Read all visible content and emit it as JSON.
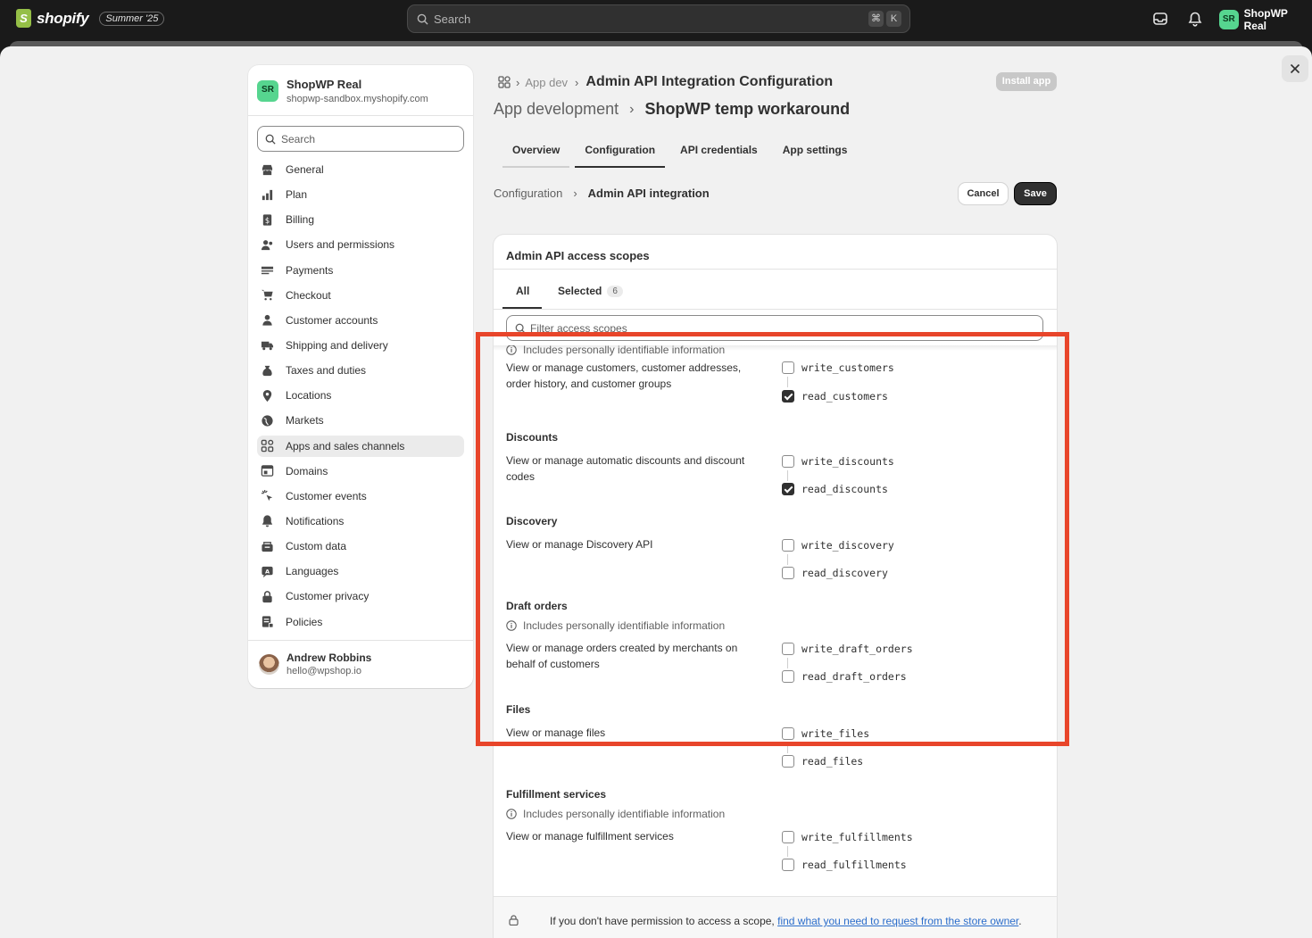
{
  "topbar": {
    "logo_text": "shopify",
    "logo_glyph": "S",
    "edition": "Summer '25",
    "search_placeholder": "Search",
    "shortcut_key1": "⌘",
    "shortcut_key2": "K",
    "store_initials": "SR",
    "store_label": "ShopWP Real"
  },
  "sidebar": {
    "store_initials": "SR",
    "store_name": "ShopWP Real",
    "store_url": "shopwp-sandbox.myshopify.com",
    "search_placeholder": "Search",
    "items": [
      {
        "label": "General",
        "icon": "store-icon"
      },
      {
        "label": "Plan",
        "icon": "plan-chart-icon"
      },
      {
        "label": "Billing",
        "icon": "billing-icon"
      },
      {
        "label": "Users and permissions",
        "icon": "users-icon"
      },
      {
        "label": "Payments",
        "icon": "payments-icon"
      },
      {
        "label": "Checkout",
        "icon": "cart-icon"
      },
      {
        "label": "Customer accounts",
        "icon": "person-icon"
      },
      {
        "label": "Shipping and delivery",
        "icon": "truck-icon"
      },
      {
        "label": "Taxes and duties",
        "icon": "tax-icon"
      },
      {
        "label": "Locations",
        "icon": "location-pin-icon"
      },
      {
        "label": "Markets",
        "icon": "globe-icon"
      },
      {
        "label": "Apps and sales channels",
        "icon": "apps-icon",
        "active": true
      },
      {
        "label": "Domains",
        "icon": "domains-icon"
      },
      {
        "label": "Customer events",
        "icon": "sparkle-cursor-icon"
      },
      {
        "label": "Notifications",
        "icon": "bell-icon"
      },
      {
        "label": "Custom data",
        "icon": "database-icon"
      },
      {
        "label": "Languages",
        "icon": "language-icon"
      },
      {
        "label": "Customer privacy",
        "icon": "lock-icon"
      },
      {
        "label": "Policies",
        "icon": "policies-icon"
      }
    ],
    "user_name": "Andrew Robbins",
    "user_email": "hello@wpshop.io"
  },
  "header": {
    "crumb_1": "App dev",
    "crumb_title": "Admin API Integration Configuration",
    "install_label": "Install app",
    "title_parent": "App development",
    "title_current": "ShopWP temp workaround",
    "tabs": [
      {
        "label": "Overview"
      },
      {
        "label": "Configuration",
        "active": true
      },
      {
        "label": "API credentials"
      },
      {
        "label": "App settings"
      }
    ],
    "sub_parent": "Configuration",
    "sub_current": "Admin API integration",
    "cancel_label": "Cancel",
    "save_label": "Save"
  },
  "card": {
    "title": "Admin API access scopes",
    "tab_all": "All",
    "tab_selected": "Selected",
    "selected_count": "6",
    "filter_placeholder": "Filter access scopes",
    "pii_text": "Includes personally identifiable information",
    "footer_text": "If you don't have permission to access a scope,",
    "footer_link": "find what you need to request from the store owner",
    "footer_end": "."
  },
  "scopes": [
    {
      "title": "",
      "pii": true,
      "description": "View or manage customers, customer addresses, order history, and customer groups",
      "write": "write_customers",
      "write_checked": false,
      "read": "read_customers",
      "read_checked": true
    },
    {
      "title": "Discounts",
      "pii": false,
      "description": "View or manage automatic discounts and discount codes",
      "write": "write_discounts",
      "write_checked": false,
      "read": "read_discounts",
      "read_checked": true
    },
    {
      "title": "Discovery",
      "pii": false,
      "description": "View or manage Discovery API",
      "write": "write_discovery",
      "write_checked": false,
      "read": "read_discovery",
      "read_checked": false
    },
    {
      "title": "Draft orders",
      "pii": true,
      "description": "View or manage orders created by merchants on behalf of customers",
      "write": "write_draft_orders",
      "write_checked": false,
      "read": "read_draft_orders",
      "read_checked": false
    },
    {
      "title": "Files",
      "pii": false,
      "description": "View or manage files",
      "write": "write_files",
      "write_checked": false,
      "read": "read_files",
      "read_checked": false
    },
    {
      "title": "Fulfillment services",
      "pii": true,
      "description": "View or manage fulfillment services",
      "write": "write_fulfillments",
      "write_checked": false,
      "read": "read_fulfillments",
      "read_checked": false
    }
  ],
  "colors": {
    "highlight": "#e8452a",
    "store_avatar": "#56d58f",
    "link": "#2c6ecb"
  }
}
